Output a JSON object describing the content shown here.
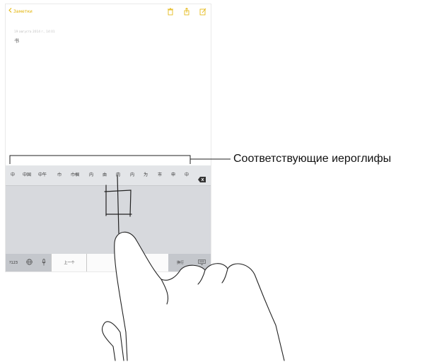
{
  "app": {
    "back_label": "Заметки",
    "note_date": "19 августа 2014 г., 14:01",
    "note_text": "书"
  },
  "nav_icons": [
    "trash-icon",
    "share-icon",
    "compose-icon"
  ],
  "keyboard": {
    "candidates": [
      "中",
      "中国",
      "中午",
      "巾",
      "巾帼",
      "内",
      "由",
      "肉",
      "内",
      "为",
      "市",
      "申",
      "中"
    ],
    "bottom": {
      "numbers_label": "?123",
      "globe_icon": "globe-icon",
      "mic_icon": "microphone-icon",
      "prev_label": "上一个",
      "confirm_label": "确认",
      "return_label": "换行",
      "hide_icon": "keyboard-hide-icon"
    }
  },
  "callout": {
    "label": "Соответствующие иероглифы"
  },
  "colors": {
    "accent": "#e2b100",
    "keyboard_bg": "#d4d6da",
    "candidate_bar_bg": "#e3e5e8"
  }
}
